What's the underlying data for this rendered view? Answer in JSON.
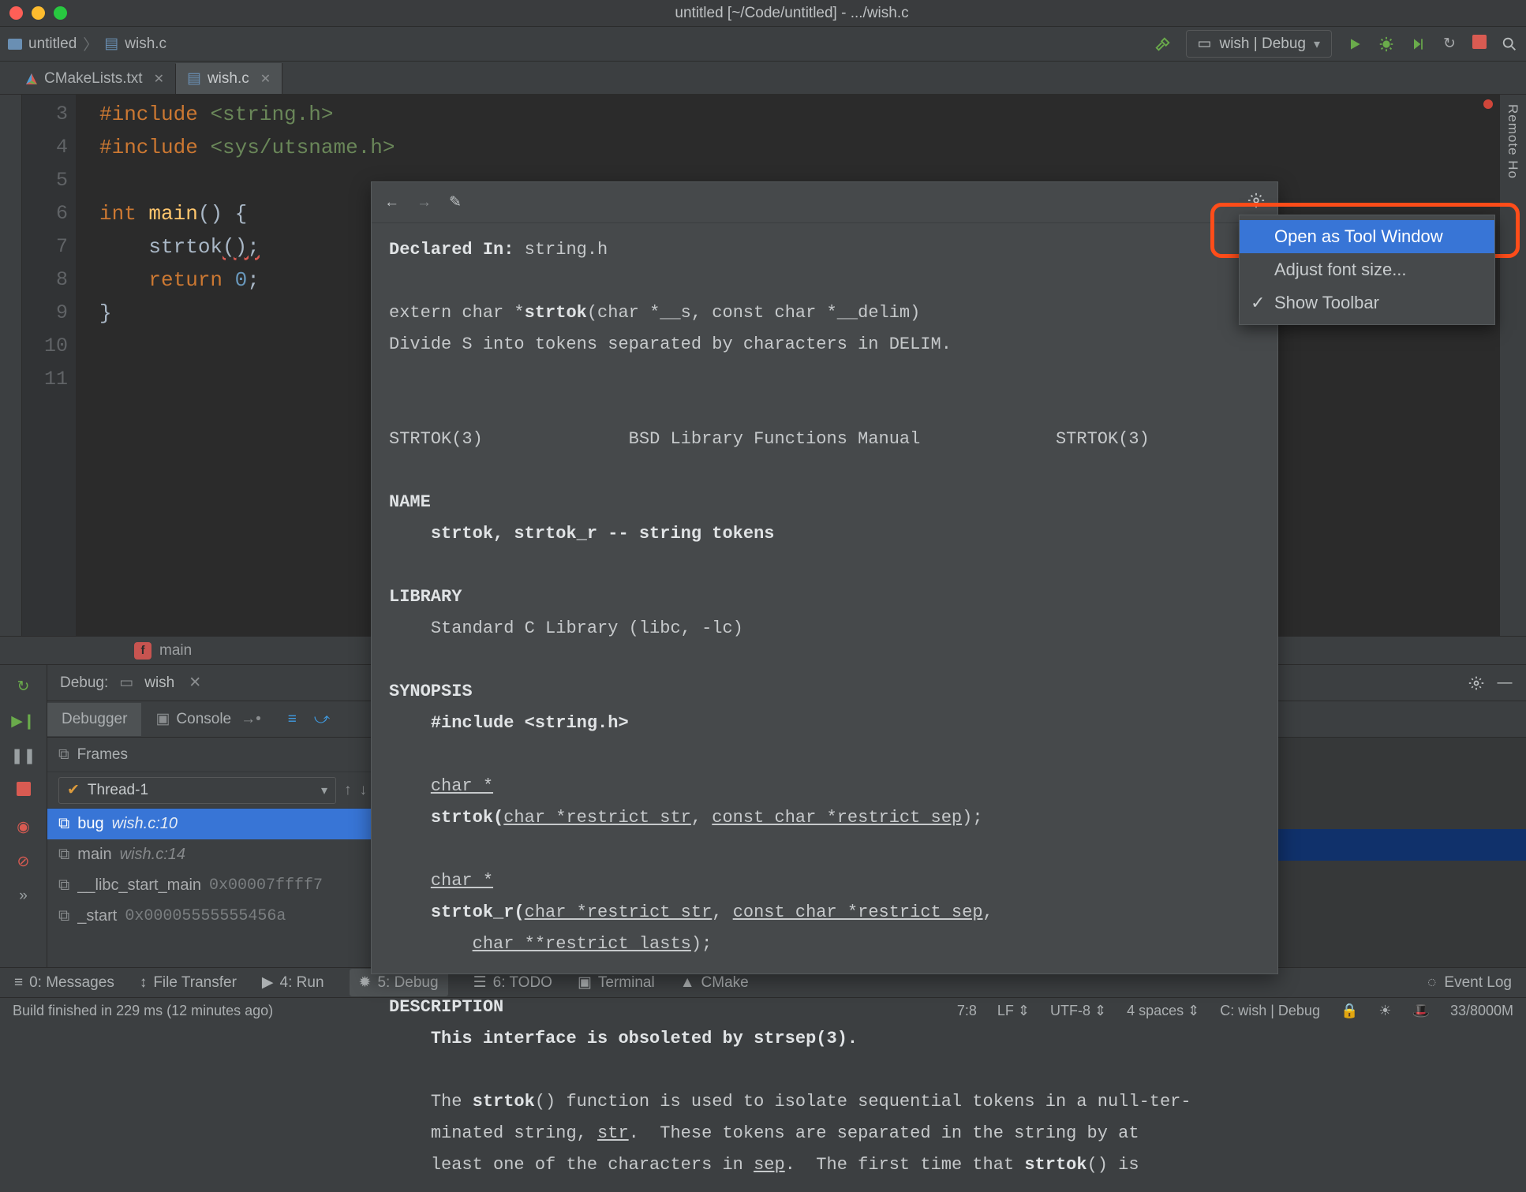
{
  "window": {
    "title": "untitled [~/Code/untitled] - .../wish.c"
  },
  "breadcrumb": {
    "project": "untitled",
    "file": "wish.c"
  },
  "runbar": {
    "config": "wish | Debug"
  },
  "tabs": [
    {
      "label": "CMakeLists.txt",
      "active": false
    },
    {
      "label": "wish.c",
      "active": true
    }
  ],
  "rightSidebar": {
    "label": "Remote Ho"
  },
  "editor": {
    "lines": [
      "3",
      "4",
      "5",
      "6",
      "7",
      "8",
      "9",
      "10",
      "11"
    ],
    "code": {
      "l3_pre": "#include ",
      "l3_inc": "<string.h>",
      "l4_pre": "#include ",
      "l4_inc": "<sys/utsname.h>",
      "l6_kw": "int ",
      "l6_fn": "main",
      "l6_rest": "() {",
      "l7_fn": "strtok",
      "l7_rest": "();",
      "l8_kw": "return ",
      "l8_num": "0",
      "l8_semi": ";",
      "l9": "}"
    },
    "crumb": "main"
  },
  "doc": {
    "declared_label": "Declared In: ",
    "declared_value": "string.h",
    "signature_pre": "extern char *",
    "signature_fn": "strtok",
    "signature_args": "(char *__s, const char *__delim)",
    "desc": "Divide S into tokens separated by characters in DELIM.",
    "man_left": "STRTOK(3)",
    "man_center": "BSD Library Functions Manual",
    "man_right": "STRTOK(3)",
    "sec_name": "NAME",
    "name_line": "strtok, strtok_r -- string tokens",
    "sec_lib": "LIBRARY",
    "lib_line": "Standard C Library (libc, -lc)",
    "sec_syn": "SYNOPSIS",
    "syn_include": "#include <string.h>",
    "syn_l1": "char *",
    "syn_l2a": "strtok(",
    "syn_l2b": "char *restrict str",
    "syn_l2c": ", ",
    "syn_l2d": "const char *restrict sep",
    "syn_l2e": ");",
    "syn_l3": "char *",
    "syn_l4a": "strtok_r(",
    "syn_l4b": "char *restrict str",
    "syn_l4c": ", ",
    "syn_l4d": "const char *restrict sep",
    "syn_l4e": ",",
    "syn_l5a": "char **restrict lasts",
    "syn_l5b": ");",
    "sec_desc": "DESCRIPTION",
    "desc1": "This interface is obsoleted by strsep(3).",
    "desc2a": "The ",
    "desc2b": "strtok",
    "desc2c": "() function is used to isolate sequential tokens in a null-ter-",
    "desc3a": "minated string, ",
    "desc3b": "str",
    "desc3c": ".  These tokens are separated in the string by at",
    "desc4a": "least one of the characters in ",
    "desc4b": "sep",
    "desc4c": ".  The first time that ",
    "desc4d": "strtok",
    "desc4e": "() is"
  },
  "gearMenu": {
    "open_tool": "Open as Tool Window",
    "adjust": "Adjust font size...",
    "show_toolbar": "Show Toolbar"
  },
  "debug": {
    "title": "Debug:",
    "target": "wish",
    "tab_debugger": "Debugger",
    "tab_console": "Console",
    "frames_label": "Frames",
    "thread": "Thread-1",
    "frames": [
      {
        "name": "bug",
        "loc": "wish.c:10",
        "sel": true
      },
      {
        "name": "main",
        "loc": "wish.c:14",
        "sel": false
      },
      {
        "name": "__libc_start_main",
        "addr": "0x00007ffff7",
        "sel": false
      },
      {
        "name": "_start",
        "addr": "0x00005555555456a",
        "sel": false
      }
    ]
  },
  "bottomTabs": {
    "messages": "0: Messages",
    "file_transfer": "File Transfer",
    "run": "4: Run",
    "debug": "5: Debug",
    "todo": "6: TODO",
    "terminal": "Terminal",
    "cmake": "CMake",
    "event_log": "Event Log"
  },
  "status": {
    "msg": "Build finished in 229 ms (12 minutes ago)",
    "pos": "7:8",
    "lf": "LF",
    "enc": "UTF-8",
    "indent": "4 spaces",
    "context": "C: wish | Debug",
    "mem": "33/8000M"
  }
}
